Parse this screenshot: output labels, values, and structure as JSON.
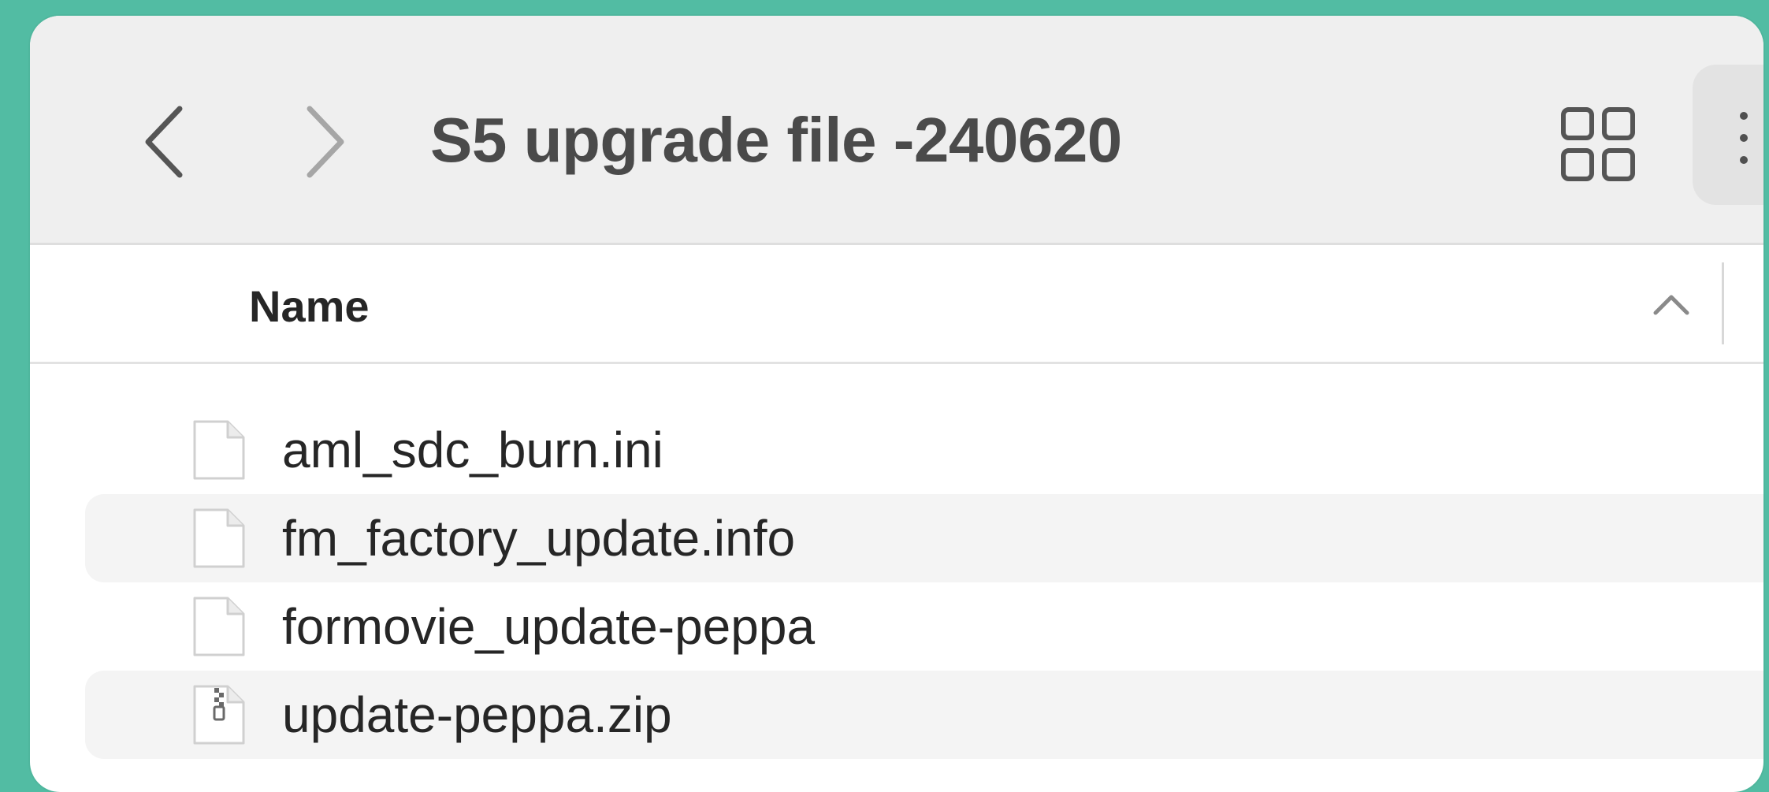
{
  "toolbar": {
    "folder_title": "S5 upgrade file -240620",
    "back_icon": "chevron-left-icon",
    "forward_icon": "chevron-right-icon",
    "view_icon": "grid-view-icon",
    "more_icon": "more-vertical-icon"
  },
  "list_header": {
    "name_column": "Name",
    "sort_icon": "chevron-up-icon"
  },
  "files": [
    {
      "name": "aml_sdc_burn.ini",
      "icon": "document-icon"
    },
    {
      "name": "fm_factory_update.info",
      "icon": "document-icon"
    },
    {
      "name": "formovie_update-peppa",
      "icon": "document-icon"
    },
    {
      "name": "update-peppa.zip",
      "icon": "zip-file-icon"
    }
  ],
  "colors": {
    "background": "#52bca3",
    "toolbar": "#efefef",
    "alt_row": "#f4f4f4"
  }
}
